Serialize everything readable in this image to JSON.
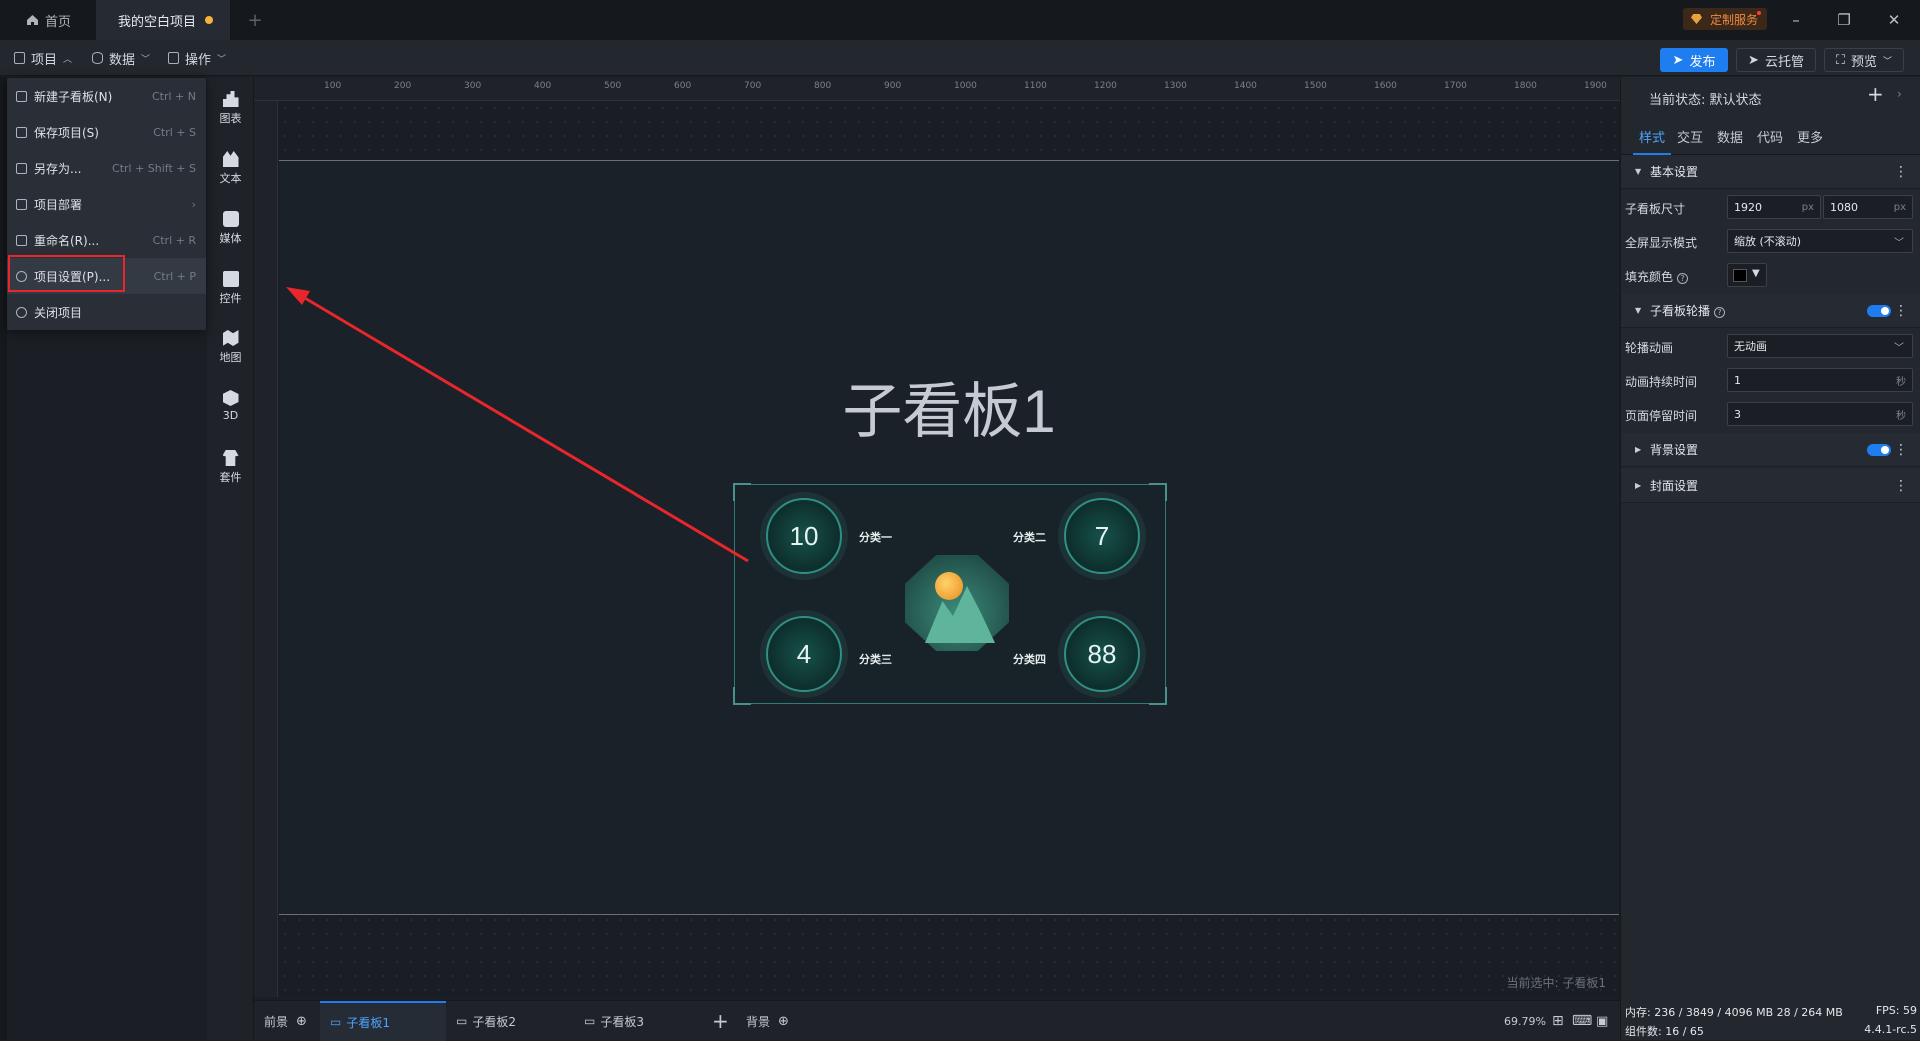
{
  "tabs": {
    "home": "首页",
    "project": "我的空白项目"
  },
  "custom_service": "定制服务",
  "menubar": {
    "project": "项目",
    "data": "数据",
    "ops": "操作"
  },
  "toolbar": {
    "publish": "发布",
    "cloud": "云托管",
    "preview": "预览"
  },
  "dropdown": [
    {
      "label": "新建子看板(N)",
      "shortcut": "Ctrl + N",
      "icon": "new-board-icon"
    },
    {
      "label": "保存项目(S)",
      "shortcut": "Ctrl + S",
      "icon": "save-icon"
    },
    {
      "label": "另存为...",
      "shortcut": "Ctrl + Shift + S",
      "icon": "save-as-icon"
    },
    {
      "label": "项目部署",
      "shortcut": "",
      "icon": "deploy-icon"
    },
    {
      "label": "重命名(R)...",
      "shortcut": "Ctrl + R",
      "icon": "rename-icon"
    },
    {
      "label": "项目设置(P)...",
      "shortcut": "Ctrl + P",
      "icon": "settings-icon"
    },
    {
      "label": "关闭项目",
      "shortcut": "",
      "icon": "close-circle-icon"
    }
  ],
  "iconbar": [
    "图表",
    "文本",
    "媒体",
    "控件",
    "地图",
    "3D",
    "套件"
  ],
  "ruler_ticks": [
    "100",
    "200",
    "300",
    "400",
    "500",
    "600",
    "700",
    "800",
    "900",
    "1000",
    "1100",
    "1200",
    "1300",
    "1400",
    "1500",
    "1600",
    "1700",
    "1800",
    "1900"
  ],
  "board": {
    "title": "子看板1",
    "values": [
      "10",
      "7",
      "4",
      "88"
    ],
    "categories": [
      "分类一",
      "分类二",
      "分类三",
      "分类四"
    ]
  },
  "current_selection": "当前选中: 子看板1",
  "bottom": {
    "front": "前景",
    "sub1": "子看板1",
    "sub2": "子看板2",
    "sub3": "子看板3",
    "plus": "+",
    "bg": "背景",
    "zoom": "69.79%"
  },
  "panel": {
    "state": "当前状态: 默认状态",
    "tabs": [
      "样式",
      "交互",
      "数据",
      "代码",
      "更多"
    ],
    "basic": "基本设置",
    "size_label": "子看板尺寸",
    "width": "1920",
    "height": "1080",
    "unit_px": "px",
    "fullscreen_label": "全屏显示模式",
    "fullscreen_value": "缩放 (不滚动)",
    "fill_label": "填充颜色",
    "carousel": "子看板轮播",
    "anim_label": "轮播动画",
    "anim_value": "无动画",
    "duration_label": "动画持续时间",
    "duration_value": "1",
    "stay_label": "页面停留时间",
    "stay_value": "3",
    "unit_s": "秒",
    "bg_settings": "背景设置",
    "cover_settings": "封面设置"
  },
  "statusbar": {
    "memory": "内存: 236 / 3849 / 4096 MB 28 / 264 MB",
    "fps": "FPS: 59",
    "components": "组件数: 16 / 65",
    "version": "4.4.1-rc.5"
  }
}
